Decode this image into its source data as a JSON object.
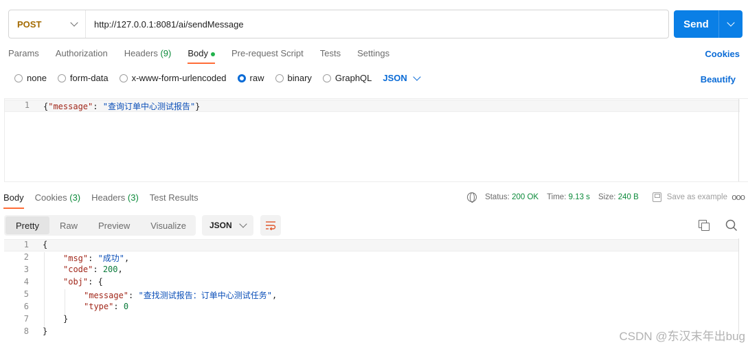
{
  "request": {
    "method": "POST",
    "url": "http://127.0.0.1:8081/ai/sendMessage",
    "send_label": "Send"
  },
  "request_tabs": [
    {
      "label": "Params"
    },
    {
      "label": "Authorization"
    },
    {
      "label": "Headers",
      "count": "(9)"
    },
    {
      "label": "Body"
    },
    {
      "label": "Pre-request Script"
    },
    {
      "label": "Tests"
    },
    {
      "label": "Settings"
    }
  ],
  "cookies_label": "Cookies",
  "body_types": [
    "none",
    "form-data",
    "x-www-form-urlencoded",
    "raw",
    "binary",
    "GraphQL"
  ],
  "body_selected": "raw",
  "body_format": "JSON",
  "beautify_label": "Beautify",
  "request_body": {
    "line_number": "1",
    "key": "\"message\"",
    "value": "\"查询订单中心测试报告\""
  },
  "response_tabs": [
    {
      "label": "Body"
    },
    {
      "label": "Cookies",
      "count": "(3)"
    },
    {
      "label": "Headers",
      "count": "(3)"
    },
    {
      "label": "Test Results"
    }
  ],
  "status": {
    "status_label": "Status:",
    "status_value": "200 OK",
    "time_label": "Time:",
    "time_value": "9.13 s",
    "size_label": "Size:",
    "size_value": "240 B",
    "save_example": "Save as example",
    "more": "ooo"
  },
  "view_modes": [
    "Pretty",
    "Raw",
    "Preview",
    "Visualize"
  ],
  "response_format": "JSON",
  "response_lines": [
    {
      "n": "1",
      "indent": 0,
      "parts": [
        {
          "t": "{",
          "c": "pun"
        }
      ]
    },
    {
      "n": "2",
      "indent": 1,
      "parts": [
        {
          "t": "\"msg\"",
          "c": "key"
        },
        {
          "t": ": ",
          "c": "pun"
        },
        {
          "t": "\"成功\"",
          "c": "str"
        },
        {
          "t": ",",
          "c": "pun"
        }
      ]
    },
    {
      "n": "3",
      "indent": 1,
      "parts": [
        {
          "t": "\"code\"",
          "c": "key"
        },
        {
          "t": ": ",
          "c": "pun"
        },
        {
          "t": "200",
          "c": "num"
        },
        {
          "t": ",",
          "c": "pun"
        }
      ]
    },
    {
      "n": "4",
      "indent": 1,
      "parts": [
        {
          "t": "\"obj\"",
          "c": "key"
        },
        {
          "t": ": {",
          "c": "pun"
        }
      ]
    },
    {
      "n": "5",
      "indent": 2,
      "parts": [
        {
          "t": "\"message\"",
          "c": "key"
        },
        {
          "t": ": ",
          "c": "pun"
        },
        {
          "t": "\"查找测试报告：订单中心测试任务\"",
          "c": "str"
        },
        {
          "t": ",",
          "c": "pun"
        }
      ]
    },
    {
      "n": "6",
      "indent": 2,
      "parts": [
        {
          "t": "\"type\"",
          "c": "key"
        },
        {
          "t": ": ",
          "c": "pun"
        },
        {
          "t": "0",
          "c": "num"
        }
      ]
    },
    {
      "n": "7",
      "indent": 1,
      "parts": [
        {
          "t": "}",
          "c": "pun"
        }
      ]
    },
    {
      "n": "8",
      "indent": 0,
      "parts": [
        {
          "t": "}",
          "c": "pun"
        }
      ]
    }
  ],
  "watermark": "CSDN @东汉末年出bug"
}
